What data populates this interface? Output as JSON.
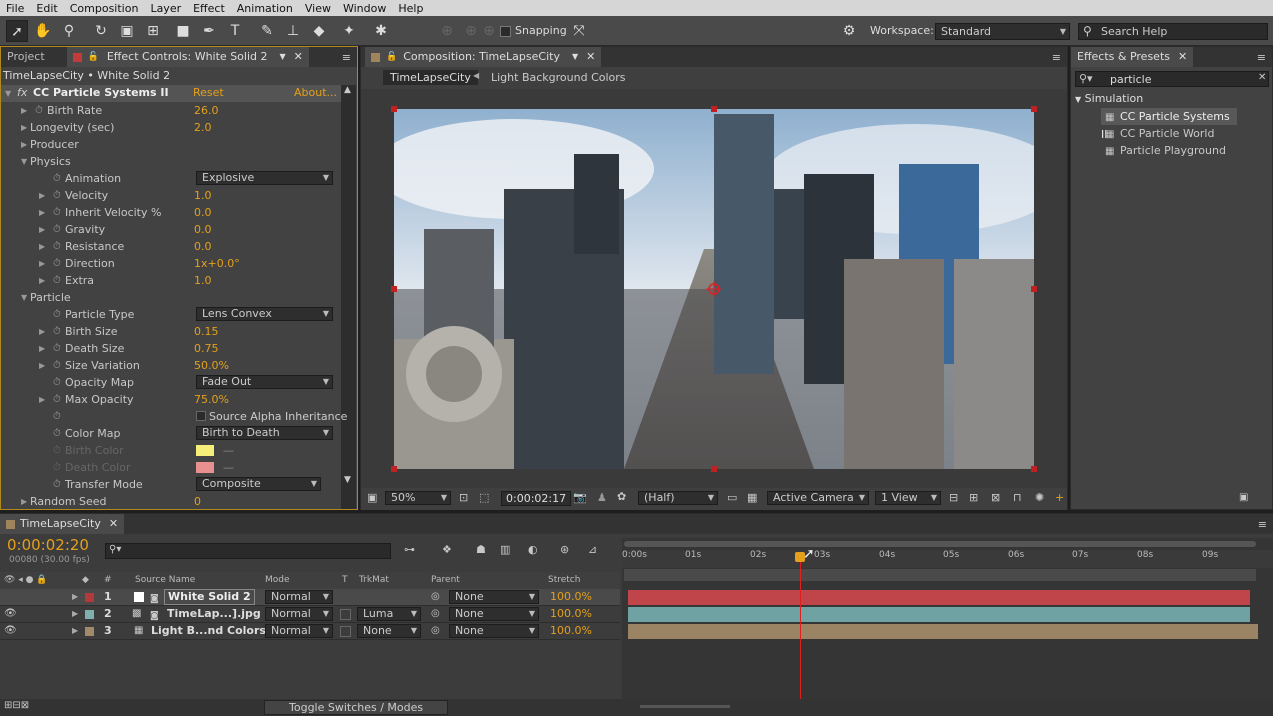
{
  "menu": [
    "File",
    "Edit",
    "Composition",
    "Layer",
    "Effect",
    "Animation",
    "View",
    "Window",
    "Help"
  ],
  "toolbar": {
    "snapping": "Snapping",
    "workspace_label": "Workspace:",
    "workspace_value": "Standard",
    "search_help": "Search Help"
  },
  "effect_controls": {
    "tab_project": "Project",
    "tab_effect": "Effect Controls: White Solid 2",
    "breadcrumb": "TimeLapseCity • White Solid 2",
    "effect_name": "CC Particle Systems II",
    "reset": "Reset",
    "about": "About...",
    "rows": [
      {
        "label": "Birth Rate",
        "value": "26.0"
      },
      {
        "label": "Longevity (sec)",
        "value": "2.0"
      },
      {
        "label": "Producer",
        "value": ""
      },
      {
        "label": "Physics",
        "value": ""
      },
      {
        "label": "Animation",
        "value": "Explosive"
      },
      {
        "label": "Velocity",
        "value": "1.0"
      },
      {
        "label": "Inherit Velocity %",
        "value": "0.0"
      },
      {
        "label": "Gravity",
        "value": "0.0"
      },
      {
        "label": "Resistance",
        "value": "0.0"
      },
      {
        "label": "Direction",
        "value": "1x+0.0°"
      },
      {
        "label": "Extra",
        "value": "1.0"
      },
      {
        "label": "Particle",
        "value": ""
      },
      {
        "label": "Particle Type",
        "value": "Lens Convex"
      },
      {
        "label": "Birth Size",
        "value": "0.15"
      },
      {
        "label": "Death Size",
        "value": "0.75"
      },
      {
        "label": "Size Variation",
        "value": "50.0%"
      },
      {
        "label": "Opacity Map",
        "value": "Fade Out"
      },
      {
        "label": "Max Opacity",
        "value": "75.0%"
      },
      {
        "label": "",
        "value": "Source Alpha Inheritance"
      },
      {
        "label": "Color Map",
        "value": "Birth to Death"
      },
      {
        "label": "Birth Color",
        "value": ""
      },
      {
        "label": "Death Color",
        "value": ""
      },
      {
        "label": "Transfer Mode",
        "value": "Composite"
      },
      {
        "label": "Random Seed",
        "value": "0"
      }
    ],
    "birth_color": "#f5ef7a",
    "death_color": "#e89090"
  },
  "composition": {
    "tab": "Composition: TimeLapseCity",
    "crumb1": "TimeLapseCity",
    "crumb2": "Light Background Colors",
    "zoom": "50%",
    "timecode": "0:00:02:17",
    "resolution": "(Half)",
    "camera": "Active Camera",
    "view": "1 View"
  },
  "effects_presets": {
    "tab": "Effects & Presets",
    "search": "particle",
    "category": "Simulation",
    "items": [
      "CC Particle Systems II",
      "CC Particle World",
      "Particle Playground"
    ]
  },
  "timeline": {
    "tab": "TimeLapseCity",
    "timecode": "0:00:02:20",
    "frames": "00080 (30.00 fps)",
    "headers": {
      "num": "#",
      "source": "Source Name",
      "mode": "Mode",
      "t": "T",
      "trkmat": "TrkMat",
      "parent": "Parent",
      "stretch": "Stretch"
    },
    "ruler": [
      "0:00s",
      "01s",
      "02s",
      "03s",
      "04s",
      "05s",
      "06s",
      "07s",
      "08s",
      "09s"
    ],
    "layers": [
      {
        "num": "1",
        "name": "White Solid 2",
        "mode": "Normal",
        "trkmat": "",
        "parent": "None",
        "stretch": "100.0%",
        "color": "#b33a3a",
        "bar": "#c0454a"
      },
      {
        "num": "2",
        "name": "TimeLap...].jpg",
        "mode": "Normal",
        "trkmat": "Luma",
        "parent": "None",
        "stretch": "100.0%",
        "color": "#7fb0b0",
        "bar": "#6fa3a3"
      },
      {
        "num": "3",
        "name": "Light B...nd Colors",
        "mode": "Normal",
        "trkmat": "None",
        "parent": "None",
        "stretch": "100.0%",
        "color": "#a08a6a",
        "bar": "#9a8463"
      }
    ],
    "toggle": "Toggle Switches / Modes"
  }
}
